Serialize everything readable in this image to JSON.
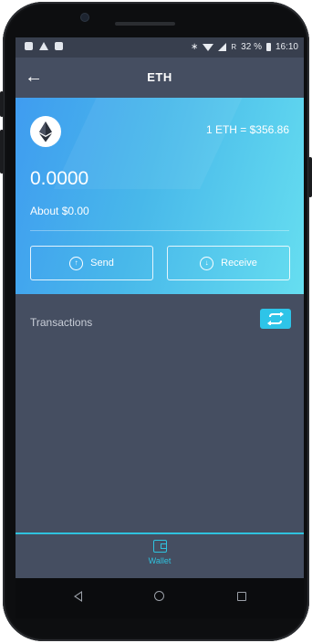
{
  "status_bar": {
    "left_icons": [
      "photo-icon",
      "navigation-icon",
      "image-icon"
    ],
    "right_icons": [
      "bluetooth-icon",
      "wifi-icon",
      "signal-icon"
    ],
    "network": "R",
    "battery": "32 %",
    "time": "16:10"
  },
  "app_bar": {
    "back_label": "←",
    "title": "ETH"
  },
  "card": {
    "logo": "ethereum-icon",
    "rate": "1 ETH = $356.86",
    "balance": "0.0000",
    "about": "About $0.00",
    "send_label": "Send",
    "receive_label": "Receive"
  },
  "transactions": {
    "title": "Transactions",
    "refresh_icon": "repeat-icon"
  },
  "bottom_nav": {
    "items": [
      {
        "label": "Wallet",
        "icon": "wallet-icon",
        "active": true
      }
    ]
  },
  "colors": {
    "background": "#454e61",
    "accent": "#2fc2de",
    "gradient_start": "#3f9cf0",
    "gradient_end": "#66def0"
  }
}
